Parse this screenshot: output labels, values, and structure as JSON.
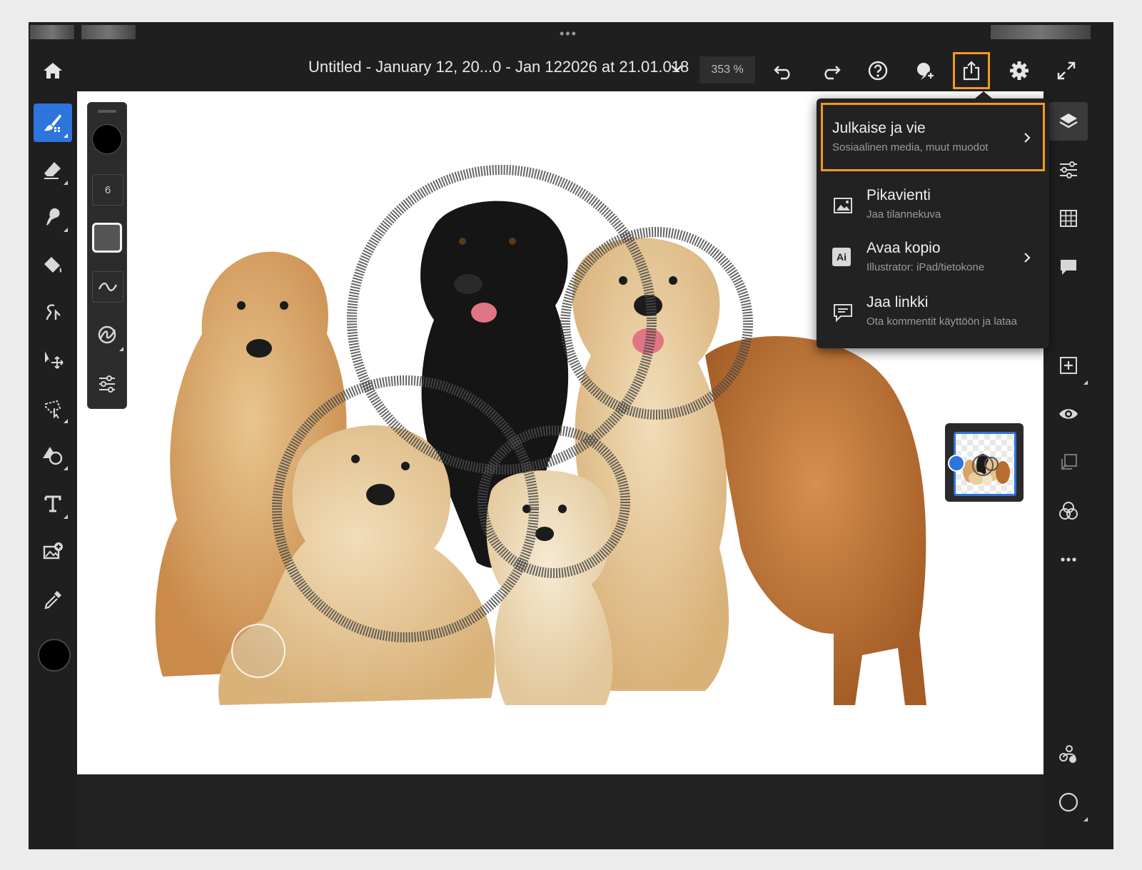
{
  "document": {
    "title": "Untitled - January 12, 20...0 - Jan 122026 at 21.01.018",
    "zoom": "353 %"
  },
  "props": {
    "brush_size": "6"
  },
  "toolbar": {
    "icons": [
      "home-icon",
      "undo-icon",
      "redo-icon",
      "help-icon",
      "invite-icon",
      "share-icon",
      "settings-icon",
      "fullscreen-icon"
    ]
  },
  "share_menu": {
    "items": [
      {
        "title": "Julkaise ja vie",
        "subtitle": "Sosiaalinen media, muut muodot"
      },
      {
        "title": "Pikavienti",
        "subtitle": "Jaa tilannekuva"
      },
      {
        "title": "Avaa kopio",
        "subtitle": "Illustrator: iPad/tietokone",
        "icon_text": "Ai"
      },
      {
        "title": "Jaa linkki",
        "subtitle": "Ota kommentit käyttöön ja lataa"
      }
    ]
  },
  "colors": {
    "accent": "#2d74dd",
    "highlight": "#f19a1f",
    "panel": "#1f1f1f"
  }
}
